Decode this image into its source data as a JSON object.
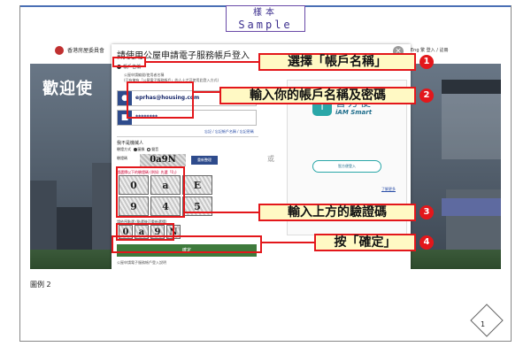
{
  "stamp": {
    "cn": "樣本",
    "en": "Sample"
  },
  "site": {
    "name": "香港房屋委員會",
    "menu": "Eng  繁  登入 / 註冊"
  },
  "welcome": "歡迎使",
  "dialog": {
    "title": "請使用公屋申請電子服務帳戶登入",
    "close": "×",
    "radio_label": "帳戶名稱",
    "hint_line1": "公屋申請編號/使用者名稱",
    "hint_line2": "(只有擁有「公屋電子服務帳戶」的人士才可使用此登入方式)",
    "username_value": "eprhas@housing.com",
    "password_value": "********",
    "links": "忘記 / 忘記帳戶名稱 / 忘記密碼",
    "section_label": "我不是機械人",
    "verify_label": "驗證方式",
    "verify_opt1": "圖像",
    "verify_opt2": "聲音",
    "code_label": "驗證碼",
    "code_value": "0a9N",
    "refresh": "重新整理",
    "grid_hint": "請選擇以下的驗證碼 (例如: 先選「0」)",
    "captcha_cells": [
      "0",
      "a",
      "E",
      "9",
      "4",
      "5"
    ],
    "answer_hint": "請依序點選 (點選後可重新選擇)",
    "answer_cells": [
      "0",
      "a",
      "9",
      "N"
    ],
    "ok": "確定",
    "bottom_note": "公屋申請電子服務帳戶登入說明"
  },
  "or": "或",
  "iam": {
    "logo": "i",
    "cn": "智方便",
    "en": "iAM Smart",
    "button": "智方便登入",
    "more": "了解更多"
  },
  "callouts": [
    {
      "num": "1",
      "text": "選擇「帳戶名稱」"
    },
    {
      "num": "2",
      "text": "輸入你的帳戶名稱及密碼"
    },
    {
      "num": "3",
      "text": "輸入上方的驗證碼"
    },
    {
      "num": "4",
      "text": "按「確定」"
    }
  ],
  "figure_label": "圖例 2",
  "page_number": "1",
  "colors": {
    "highlight": "#e3171b",
    "callout_bg": "#fff9c4",
    "ok_green": "#3e7a3c",
    "brand_blue": "#2e4b8c"
  }
}
